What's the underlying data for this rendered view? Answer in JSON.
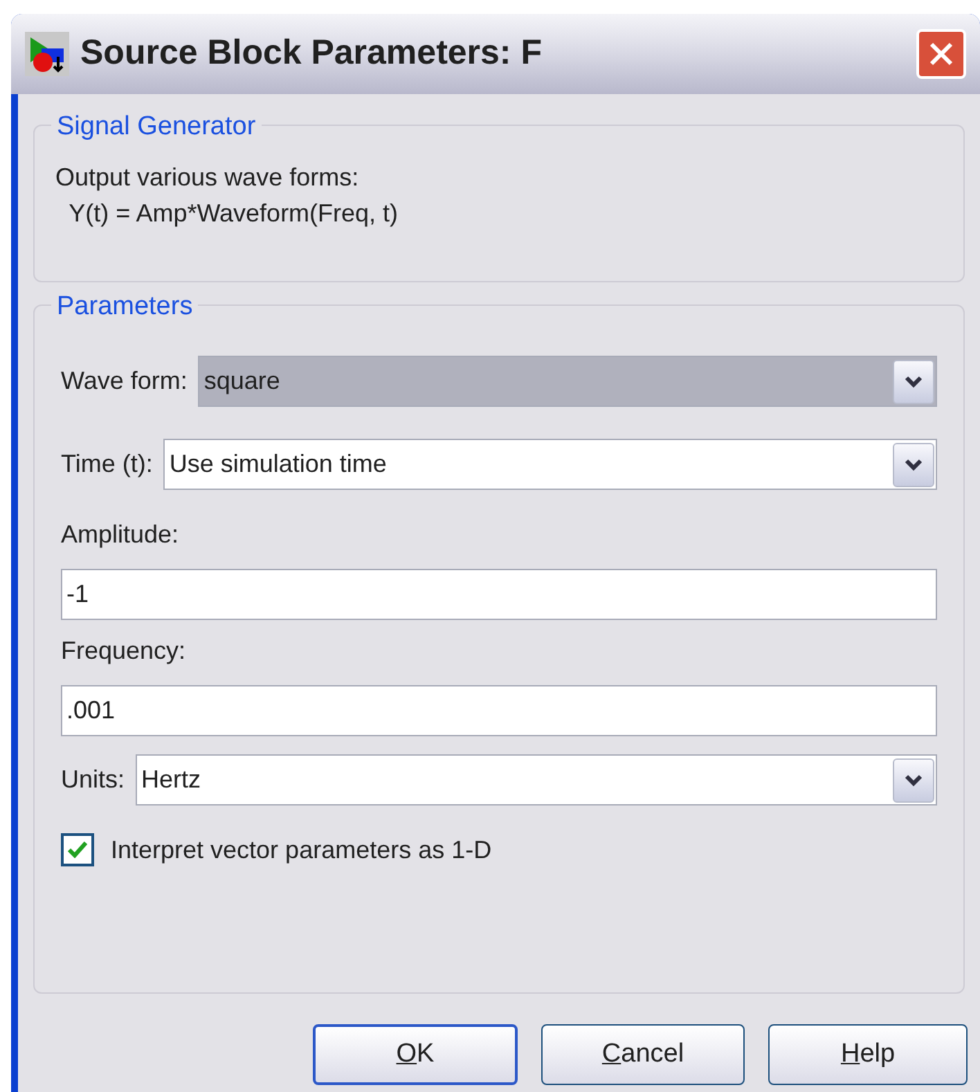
{
  "window": {
    "title": "Source Block Parameters: F"
  },
  "description_group": {
    "title": "Signal Generator",
    "lines": [
      "Output various wave forms:",
      "  Y(t) = Amp*Waveform(Freq, t)"
    ]
  },
  "parameters_group": {
    "title": "Parameters",
    "fields": [
      {
        "kind": "combo",
        "label": "Wave form:",
        "value": "square",
        "focused": true
      },
      {
        "kind": "combo",
        "label": "Time (t):",
        "value": "Use simulation time",
        "focused": false
      },
      {
        "kind": "text",
        "label": "Amplitude:",
        "value": "-1"
      },
      {
        "kind": "text",
        "label": "Frequency:",
        "value": ".001"
      },
      {
        "kind": "combo",
        "label": "Units:",
        "value": "Hertz",
        "focused": false
      },
      {
        "kind": "checkbox",
        "label": "Interpret vector parameters as 1-D",
        "checked": true
      }
    ]
  },
  "buttons": [
    {
      "mnemonic": "O",
      "rest": "K",
      "default": true
    },
    {
      "mnemonic": "C",
      "rest": "ancel",
      "default": false
    },
    {
      "mnemonic": "H",
      "rest": "elp",
      "default": false
    }
  ]
}
